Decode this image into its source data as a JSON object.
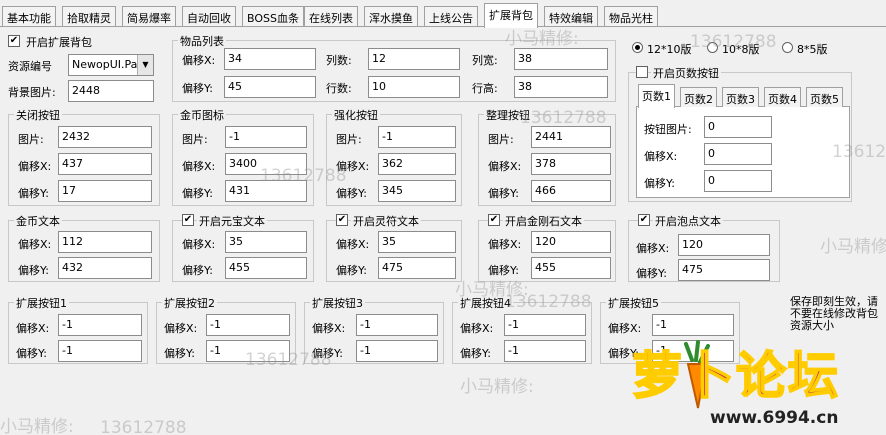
{
  "tabs": [
    "基本功能",
    "拾取精灵",
    "简易爆率",
    "自动回收",
    "BOSS血条",
    "在线列表",
    "浑水摸鱼",
    "上线公告",
    "扩展背包",
    "特效编辑",
    "物品光柱"
  ],
  "active_tab": "扩展背包",
  "bag": {
    "enable_label": "开启扩展背包",
    "enabled": true,
    "res_label": "资源编号",
    "res_value": "NewopUI.Pak",
    "bg_label": "背景图片:",
    "bg_value": "2448"
  },
  "items": {
    "title": "物品列表",
    "offx_label": "偏移X:",
    "offx": "34",
    "offy_label": "偏移Y:",
    "offy": "45",
    "cols_label": "列数:",
    "cols": "12",
    "rows_label": "行数:",
    "rows": "10",
    "colw_label": "列宽:",
    "colw": "38",
    "rowh_label": "行高:",
    "rowh": "38"
  },
  "close_btn": {
    "title": "关闭按钮",
    "img_label": "图片:",
    "img": "2432",
    "x_label": "偏移X:",
    "x": "437",
    "y_label": "偏移Y:",
    "y": "17"
  },
  "gold_icon": {
    "title": "金币图标",
    "img_label": "图片:",
    "img": "-1",
    "x_label": "偏移X:",
    "x": "3400",
    "y_label": "偏移Y:",
    "y": "431"
  },
  "strengthen_btn": {
    "title": "强化按钮",
    "img_label": "图片:",
    "img": "-1",
    "x_label": "偏移X:",
    "x": "362",
    "y_label": "偏移Y:",
    "y": "345"
  },
  "tidy_btn": {
    "title": "整理按钮",
    "img_label": "图片:",
    "img": "2441",
    "x_label": "偏移X:",
    "x": "378",
    "y_label": "偏移Y:",
    "y": "466"
  },
  "gold_text": {
    "title": "金币文本",
    "x_label": "偏移X:",
    "x": "112",
    "y_label": "偏移Y:",
    "y": "432"
  },
  "ingot_text": {
    "title": "开启元宝文本",
    "x_label": "偏移X:",
    "x": "35",
    "y_label": "偏移Y:",
    "y": "455"
  },
  "soul_text": {
    "title": "开启灵符文本",
    "x_label": "偏移X:",
    "x": "35",
    "y_label": "偏移Y:",
    "y": "475"
  },
  "diamond_text": {
    "title": "开启金刚石文本",
    "x_label": "偏移X:",
    "x": "120",
    "y_label": "偏移Y:",
    "y": "455"
  },
  "bubble_text": {
    "title": "开启泡点文本",
    "x_label": "偏移X:",
    "x": "120",
    "y_label": "偏移Y:",
    "y": "475"
  },
  "ext": [
    {
      "title": "扩展按钮1",
      "x_label": "偏移X:",
      "x": "-1",
      "y_label": "偏移Y:",
      "y": "-1"
    },
    {
      "title": "扩展按钮2",
      "x_label": "偏移X:",
      "x": "-1",
      "y_label": "偏移Y:",
      "y": "-1"
    },
    {
      "title": "扩展按钮3",
      "x_label": "偏移X:",
      "x": "-1",
      "y_label": "偏移Y:",
      "y": "-1"
    },
    {
      "title": "扩展按钮4",
      "x_label": "偏移X:",
      "x": "-1",
      "y_label": "偏移Y:",
      "y": "-1"
    },
    {
      "title": "扩展按钮5",
      "x_label": "偏移X:",
      "x": "-1",
      "y_label": "偏移Y:",
      "y": "-1"
    }
  ],
  "versions": [
    "12*10版",
    "10*8版",
    "8*5版"
  ],
  "version_selected": "12*10版",
  "pages": {
    "enable_label": "开启页数按钮",
    "tabs": [
      "页数1",
      "页数2",
      "页数3",
      "页数4",
      "页数5"
    ],
    "active": "页数1",
    "img_label": "按钮图片:",
    "img": "0",
    "x_label": "偏移X:",
    "x": "0",
    "y_label": "偏移Y:",
    "y": "0"
  },
  "note": "保存即刻生效，请不要在线修改背包资源大小",
  "watermark": {
    "name": "小马精修:",
    "phone": "13612788"
  },
  "logo": {
    "text": "萝卜论坛",
    "url": "www.6994.cn",
    "colors": {
      "primary": "#b0007a",
      "accent": "#ffcc00"
    }
  }
}
